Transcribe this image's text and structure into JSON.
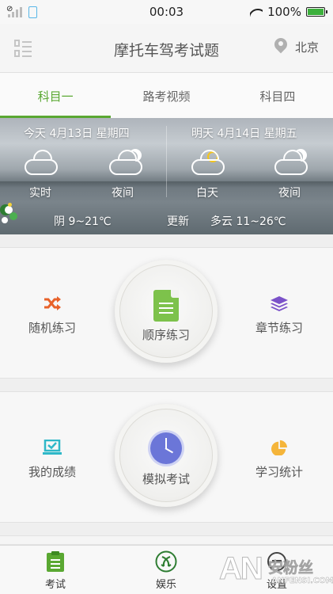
{
  "status_bar": {
    "time": "00:03",
    "battery": "100%",
    "battery_level": 1.0
  },
  "header": {
    "title": "摩托车驾考试题",
    "location": "北京"
  },
  "tabs": [
    {
      "label": "科目一",
      "active": true
    },
    {
      "label": "路考视频",
      "active": false
    },
    {
      "label": "科目四",
      "active": false
    }
  ],
  "weather": {
    "today": {
      "date": "今天 4月13日 星期四",
      "left_label": "实时",
      "right_label": "夜间",
      "summary": "阴 9~21℃"
    },
    "tomorrow": {
      "date": "明天 4月14日 星期五",
      "left_label": "白天",
      "right_label": "夜间",
      "summary": "多云 11~26℃"
    },
    "update_label": "更新"
  },
  "practice": {
    "random": "随机练习",
    "sequential": "顺序练习",
    "chapter": "章节练习"
  },
  "exam": {
    "scores": "我的成绩",
    "mock": "模拟考试",
    "stats": "学习统计"
  },
  "bottom_nav": [
    {
      "label": "考试",
      "icon": "clipboard-icon"
    },
    {
      "label": "娱乐",
      "icon": "ribbon-icon"
    },
    {
      "label": "设置",
      "icon": "settings-icon"
    }
  ],
  "watermark": {
    "brand": "AN",
    "name": "安粉丝",
    "site": "ANFENSI.COM"
  },
  "colors": {
    "accent": "#5aa832",
    "clock": "#6b76d8",
    "shuffle": "#e8622a",
    "chapter": "#7b52c9",
    "chart": "#f5b53a",
    "scores": "#2fb8c8"
  }
}
